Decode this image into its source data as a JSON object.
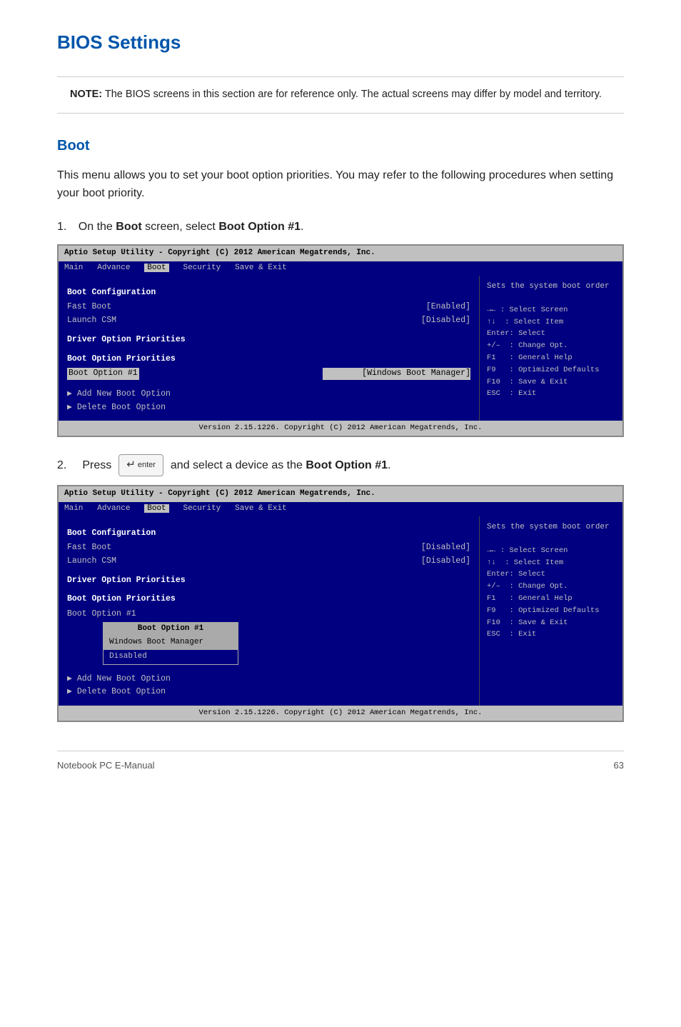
{
  "page": {
    "title": "BIOS Settings",
    "note": {
      "bold": "NOTE:",
      "text": " The BIOS screens in this section are for reference only. The actual screens may differ by model and territory."
    },
    "section": {
      "title": "Boot",
      "description": "This menu allows you to set your boot option priorities. You may refer to the following procedures when setting your boot priority."
    },
    "steps": [
      {
        "num": "1.",
        "text_prefix": "On the ",
        "text_bold1": "Boot",
        "text_middle": " screen, select ",
        "text_bold2": "Boot Option #1",
        "text_suffix": "."
      },
      {
        "num": "2.",
        "text_prefix": "Press ",
        "enter_label": "enter↵",
        "text_suffix": " and select a device as the ",
        "text_bold": "Boot Option #1",
        "text_end": "."
      }
    ],
    "bios1": {
      "title_bar": "Aptio Setup Utility - Copyright (C) 2012 American Megatrends, Inc.",
      "menu": {
        "items": [
          "Main",
          "Advance",
          "Boot",
          "Security",
          "Save & Exit"
        ],
        "active": "Boot"
      },
      "left": {
        "section1": "Boot Configuration",
        "rows": [
          {
            "label": "Fast Boot",
            "value": "[Enabled]"
          },
          {
            "label": "Launch CSM",
            "value": "[Disabled]"
          }
        ],
        "section2": "Driver Option Priorities",
        "section3": "Boot Option Priorities",
        "boot_option_row": {
          "label": "Boot Option #1",
          "value": "[Windows Boot Manager]"
        },
        "links": [
          "Add New Boot Option",
          "Delete Boot Option"
        ]
      },
      "right": {
        "help_text": "Sets the system boot order",
        "keys": [
          "→← : Select Screen",
          "↑↓  : Select Item",
          "Enter: Select",
          "+/-  : Change Opt.",
          "F1   : General Help",
          "F9   : Optimized Defaults",
          "F10  : Save & Exit",
          "ESC  : Exit"
        ]
      },
      "footer": "Version 2.15.1226. Copyright (C) 2012 American Megatrends, Inc."
    },
    "bios2": {
      "title_bar": "Aptio Setup Utility - Copyright (C) 2012 American Megatrends, Inc.",
      "menu": {
        "items": [
          "Main",
          "Advance",
          "Boot",
          "Security",
          "Save & Exit"
        ],
        "active": "Boot"
      },
      "left": {
        "section1": "Boot Configuration",
        "rows": [
          {
            "label": "Fast Boot",
            "value": "[Disabled]"
          },
          {
            "label": "Launch CSM",
            "value": "[Disabled]"
          }
        ],
        "section2": "Driver Option Priorities",
        "section3": "Boot Option Priorities",
        "boot_option_row": {
          "label": "Boot Option #1",
          "value": ""
        },
        "links": [
          "Add New Boot Option",
          "Delete Boot Option"
        ],
        "popup": {
          "title": "Boot Option #1",
          "items": [
            "Windows Boot Manager",
            "Disabled"
          ],
          "selected": "Windows Boot Manager"
        }
      },
      "right": {
        "help_text": "Sets the system boot order",
        "keys": [
          "→← : Select Screen",
          "↑↓  : Select Item",
          "Enter: Select",
          "+/-  : Change Opt.",
          "F1   : General Help",
          "F9   : Optimized Defaults",
          "F10  : Save & Exit",
          "ESC  : Exit"
        ]
      },
      "footer": "Version 2.15.1226. Copyright (C) 2012 American Megatrends, Inc."
    },
    "footer": {
      "left": "Notebook PC E-Manual",
      "right": "63"
    }
  }
}
